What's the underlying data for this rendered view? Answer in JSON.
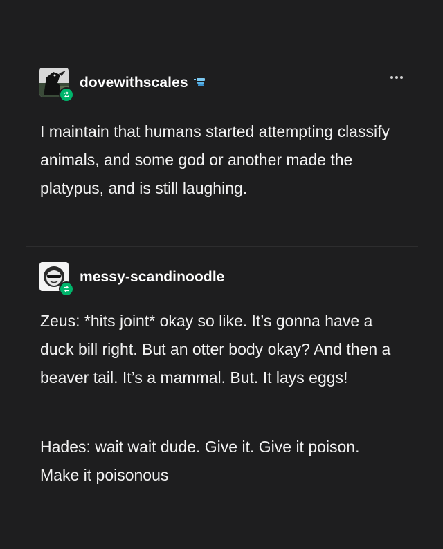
{
  "post": {
    "more_icon": "more-horizontal-icon",
    "original": {
      "username": "dovewithscales",
      "avatar_icon": "avatar-raven-image",
      "badge_icon": "blue-badge-icon",
      "reblog_icon": "reblog-icon",
      "text": "I maintain that humans started attempting classify animals, and some god or another made the platypus, and is still laughing."
    },
    "reblog": {
      "username": "messy-scandinoodle",
      "avatar_icon": "avatar-sunglasses-image",
      "reblog_icon": "reblog-icon",
      "paragraphs": [
        "Zeus:  *hits joint* okay so like. It’s gonna have a duck bill right. But an otter body okay? And then a beaver tail. It’s a mammal. But. It lays eggs!",
        "Hades:  wait wait dude. Give it. Give it poison. Make it poisonous"
      ]
    },
    "colors": {
      "background": "#1e1e1f",
      "text": "#f2f2f2",
      "reblog_badge": "#00b46b",
      "user_badge": "#5ab4e8"
    }
  }
}
